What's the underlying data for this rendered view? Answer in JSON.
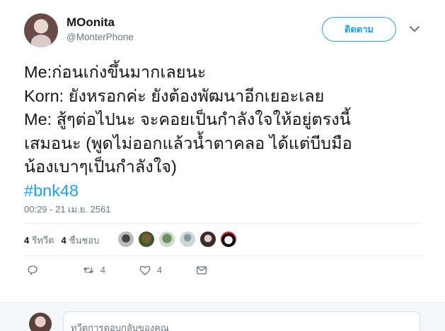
{
  "author": {
    "display_name": "MOonita",
    "handle": "@MonterPhone"
  },
  "follow_button_label": "ติดตาม",
  "tweet": {
    "lines": [
      "Me:ก่อนเก่งขึ้นมากเลยนะ",
      "Korn: ยังหรอกค่ะ ยังต้องพัฒนาอีกเยอะเลย",
      "Me: สู้ๆต่อไปนะ จะคอยเป็นกำลังใจให้อยู่ตรงนี้",
      "เสมอนะ (พูดไม่ออกแล้วน้ำตาคลอ ได้แต่บีบมือ",
      "น้องเบาๆเป็นกำลังใจ)"
    ],
    "hashtag": "#bnk48",
    "timestamp": "00:29 - 21 เม.ย. 2561"
  },
  "stats": {
    "retweets_count": "4",
    "retweets_label": "รีทวีต",
    "likes_count": "4",
    "likes_label": "ชื่นชอบ"
  },
  "actions": {
    "reply_count": "",
    "retweet_count": "4",
    "like_count": "4"
  },
  "reply": {
    "placeholder": "ทวีตการตอบกลับของคุณ"
  },
  "icons": [
    "avatar",
    "chevron-down-icon",
    "reply-icon",
    "retweet-icon",
    "heart-icon",
    "message-icon"
  ],
  "colors": {
    "accent": "#1da1f2",
    "muted": "#657786",
    "text": "#14171a"
  }
}
